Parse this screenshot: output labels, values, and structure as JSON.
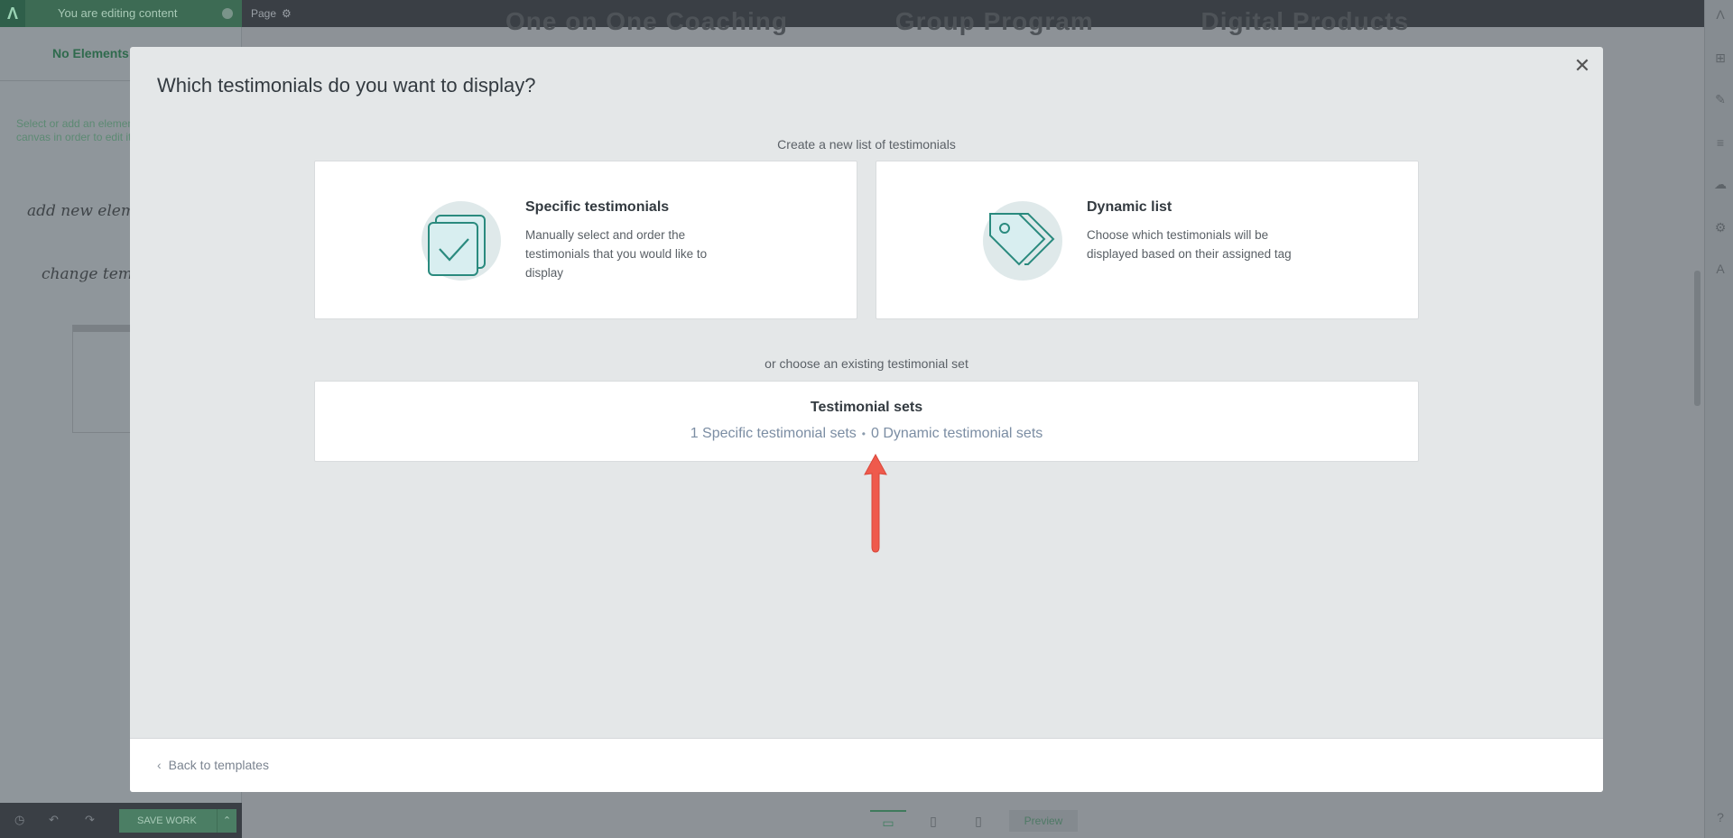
{
  "topbar": {
    "editing_label": "You are editing content",
    "page_label": "Page"
  },
  "background_headings": [
    "One on One Coaching",
    "Group Program",
    "Digital Products"
  ],
  "leftpanel": {
    "no_elements": "No Elements",
    "hint": "Select or add an element on the canvas in order to edit it",
    "sketch_add": "add new element",
    "sketch_change": "change template"
  },
  "bottombar": {
    "save_label": "SAVE WORK"
  },
  "devices": {
    "preview_label": "Preview"
  },
  "modal": {
    "title": "Which testimonials do you want to display?",
    "create_label": "Create a new list of testimonials",
    "specific": {
      "title": "Specific testimonials",
      "description": "Manually select and order the testimonials that you would like to display"
    },
    "dynamic": {
      "title": "Dynamic list",
      "description": "Choose which testimonials will be displayed based on their assigned tag"
    },
    "existing_label": "or choose an existing testimonial set",
    "sets": {
      "title": "Testimonial sets",
      "specific_link": "1 Specific testimonial sets",
      "separator": "•",
      "dynamic_link": "0 Dynamic testimonial sets"
    },
    "back_label": "Back to templates"
  },
  "colors": {
    "accent_teal": "#2a8a7e",
    "annotation_arrow": "#ef5a4c",
    "link_blue_grey": "#7b8da3"
  }
}
